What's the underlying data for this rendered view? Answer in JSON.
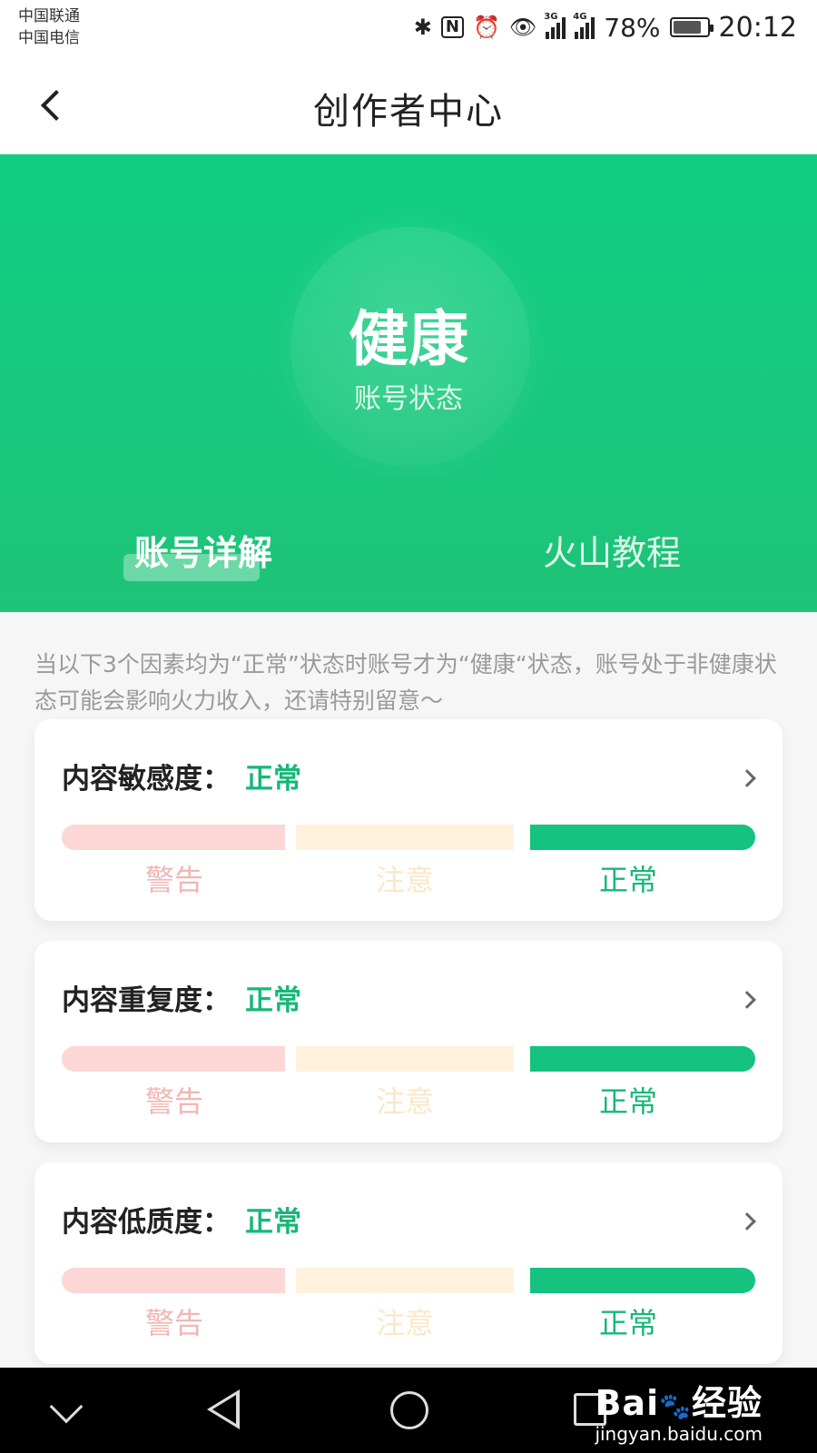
{
  "status_bar": {
    "carrier1": "中国联通",
    "carrier2": "中国电信",
    "network1": "3G",
    "network2": "4G",
    "battery": "78%",
    "time": "20:12"
  },
  "header": {
    "title": "创作者中心"
  },
  "hero": {
    "status": "健康",
    "status_label": "账号状态"
  },
  "tabs": [
    {
      "label": "账号详解"
    },
    {
      "label": "火山教程"
    }
  ],
  "intro": "当以下3个因素均为“正常”状态时账号才为“健康“状态，账号处于非健康状态可能会影响火力收入，还请特别留意～",
  "cards": [
    {
      "title": "内容敏感度：",
      "value": "正常",
      "scale": [
        "警告",
        "注意",
        "正常"
      ]
    },
    {
      "title": "内容重复度：",
      "value": "正常",
      "scale": [
        "警告",
        "注意",
        "正常"
      ]
    },
    {
      "title": "内容低质度：",
      "value": "正常",
      "scale": [
        "警告",
        "注意",
        "正常"
      ]
    }
  ],
  "watermark": {
    "logo": "Bai",
    "logo_paw": "🐾",
    "logo_suffix": "经验",
    "url": "jingyan.baidu.com"
  },
  "icons": {
    "bluetooth": "bluetooth-icon",
    "nfc": "nfc-icon",
    "alarm": "alarm-icon",
    "eye": "eye-icon"
  },
  "colors": {
    "green": "#15c27f",
    "warn": "#fdd6d6",
    "caution": "#fff1dc"
  }
}
